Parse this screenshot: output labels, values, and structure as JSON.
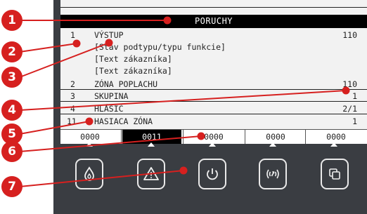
{
  "lcd": {
    "title": "PORUCHY",
    "rows": [
      {
        "num": "1",
        "text": "VÝSTUP",
        "value": "110"
      },
      {
        "num": "",
        "text": "[Stav podtypu/typu funkcie]",
        "value": ""
      },
      {
        "num": "",
        "text": "[Text zákazníka]",
        "value": ""
      },
      {
        "num": "",
        "text": "[Text zákazníka]",
        "value": ""
      },
      {
        "num": "2",
        "text": "ZÓNA POPLACHU",
        "value": "110"
      },
      {
        "num": "3",
        "text": "SKUPINA",
        "value": "1"
      },
      {
        "num": "4",
        "text": "HLÁSIČ",
        "value": "2/1"
      },
      {
        "num": "11",
        "text": "HASIACA ZÓNA",
        "value": "1"
      }
    ],
    "softkeys": [
      "0000",
      "0011",
      "0000",
      "0000",
      "0000"
    ],
    "active_softkey_index": 1
  },
  "buttons": [
    {
      "icon": "fire-drop-icon"
    },
    {
      "icon": "warning-triangle-icon"
    },
    {
      "icon": "power-icon"
    },
    {
      "icon": "signal-waves-icon"
    },
    {
      "icon": "copy-squares-icon"
    }
  ],
  "callouts": [
    "1",
    "2",
    "3",
    "4",
    "5",
    "6",
    "7"
  ],
  "colors": {
    "callout": "#d6201f",
    "panel": "#3a3d42",
    "lcd": "#f2f2f2"
  }
}
